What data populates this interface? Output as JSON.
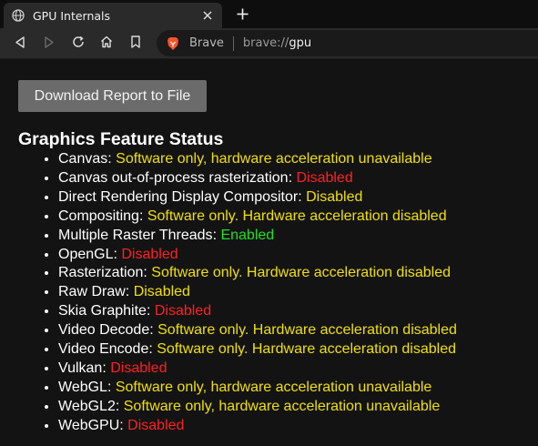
{
  "tab": {
    "title": "GPU Internals"
  },
  "toolbar": {
    "url_brand": "Brave",
    "url_scheme": "brave://",
    "url_host": "gpu"
  },
  "page": {
    "download_button": "Download Report to File",
    "section_title": "Graphics Feature Status",
    "features": [
      {
        "name": "Canvas",
        "status": "Software only, hardware acceleration unavailable",
        "color": "#f0e000"
      },
      {
        "name": "Canvas out-of-process rasterization",
        "status": "Disabled",
        "color": "#ff2020"
      },
      {
        "name": "Direct Rendering Display Compositor",
        "status": "Disabled",
        "color": "#f0e000"
      },
      {
        "name": "Compositing",
        "status": "Software only. Hardware acceleration disabled",
        "color": "#f0e000"
      },
      {
        "name": "Multiple Raster Threads",
        "status": "Enabled",
        "color": "#20e020"
      },
      {
        "name": "OpenGL",
        "status": "Disabled",
        "color": "#ff2020"
      },
      {
        "name": "Rasterization",
        "status": "Software only. Hardware acceleration disabled",
        "color": "#f0e000"
      },
      {
        "name": "Raw Draw",
        "status": "Disabled",
        "color": "#f0e000"
      },
      {
        "name": "Skia Graphite",
        "status": "Disabled",
        "color": "#ff2020"
      },
      {
        "name": "Video Decode",
        "status": "Software only. Hardware acceleration disabled",
        "color": "#f0e000"
      },
      {
        "name": "Video Encode",
        "status": "Software only. Hardware acceleration disabled",
        "color": "#f0e000"
      },
      {
        "name": "Vulkan",
        "status": "Disabled",
        "color": "#ff2020"
      },
      {
        "name": "WebGL",
        "status": "Software only, hardware acceleration unavailable",
        "color": "#f0e000"
      },
      {
        "name": "WebGL2",
        "status": "Software only, hardware acceleration unavailable",
        "color": "#f0e000"
      },
      {
        "name": "WebGPU",
        "status": "Disabled",
        "color": "#ff2020"
      }
    ]
  }
}
